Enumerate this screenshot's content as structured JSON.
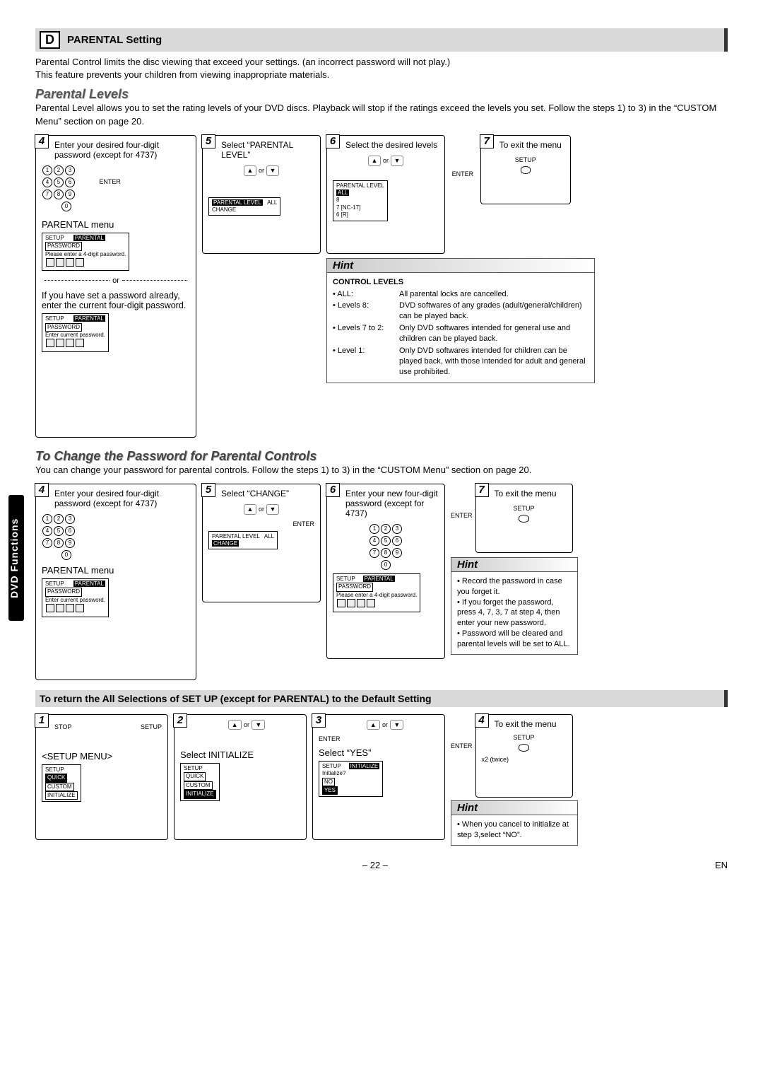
{
  "section_d": {
    "letter": "D",
    "title": "PARENTAL Setting"
  },
  "intro": {
    "line1": "Parental Control limits the disc viewing that exceed your settings. (an incorrect password will not play.)",
    "line2": "This feature prevents your children from viewing inappropriate materials."
  },
  "parental_levels": {
    "heading": "Parental Levels",
    "body": "Parental Level allows you to set the rating levels of your DVD discs. Playback will stop if the ratings exceed the levels you set. Follow the steps 1) to 3) in the “CUSTOM Menu” section on page 20."
  },
  "steps_pl": {
    "s4": {
      "num": "4",
      "text": "Enter your desired four-digit password (except for 4737)",
      "menu_label": "PARENTAL menu"
    },
    "s4_osd1": {
      "top1": "SETUP",
      "top2": "PARENTAL",
      "row": "PASSWORD",
      "msg": "Please enter a 4-digit password."
    },
    "or": "or",
    "s4_alt": "If you have set a password already, enter the current four-digit password.",
    "s4_osd2": {
      "top1": "SETUP",
      "top2": "PARENTAL",
      "row": "PASSWORD",
      "msg": "Enter current password."
    },
    "enter_label": "ENTER",
    "s5": {
      "num": "5",
      "text": "Select “PARENTAL LEVEL”",
      "or": "or",
      "osd": {
        "r1": "PARENTAL LEVEL",
        "v1": "ALL",
        "r2": "CHANGE"
      }
    },
    "s6": {
      "num": "6",
      "text": "Select the desired levels",
      "or": "or",
      "osd": {
        "h": "PARENTAL LEVEL",
        "o1": "ALL",
        "o2": "8",
        "o3": "7 [NC-17]",
        "o4": "6 [R]"
      }
    },
    "s7": {
      "num": "7",
      "text": "To exit the menu",
      "setup": "SETUP"
    }
  },
  "hint1": {
    "title": "Hint",
    "section": "CONTROL LEVELS",
    "rows": [
      {
        "k": "• ALL:",
        "v": "All parental locks are cancelled."
      },
      {
        "k": "• Levels 8:",
        "v": "DVD softwares of any grades (adult/general/children) can be played back."
      },
      {
        "k": "• Levels 7 to 2:",
        "v": "Only DVD softwares intended for general use and children can be played back."
      },
      {
        "k": "• Level 1:",
        "v": "Only DVD softwares intended for children can be played back, with those intended for adult and general use prohibited."
      }
    ]
  },
  "change_pw": {
    "heading": "To Change the Password for Parental Controls",
    "body": "You can change your password for parental controls.  Follow the steps 1) to 3) in the “CUSTOM Menu” section on page 20."
  },
  "steps_cp": {
    "s4": {
      "num": "4",
      "text": "Enter your desired four-digit password (except for 4737)",
      "menu_label": "PARENTAL menu",
      "osd": {
        "top1": "SETUP",
        "top2": "PARENTAL",
        "row": "PASSWORD",
        "msg": "Enter current password."
      }
    },
    "s5": {
      "num": "5",
      "text": "Select “CHANGE”",
      "or": "or",
      "enter": "ENTER",
      "osd": {
        "r1": "PARENTAL LEVEL",
        "v1": "ALL",
        "r2": "CHANGE"
      }
    },
    "s6": {
      "num": "6",
      "text": "Enter your new four-digit password (except for 4737)",
      "osd": {
        "top1": "SETUP",
        "top2": "PARENTAL",
        "row": "PASSWORD",
        "msg": "Please enter a 4-digit password."
      }
    },
    "s7": {
      "num": "7",
      "text": "To exit the menu",
      "setup": "SETUP",
      "enter": "ENTER"
    }
  },
  "hint2": {
    "title": "Hint",
    "items": [
      "Record the password in case you forget it.",
      "If you forget the password, press 4, 7, 3, 7 at step 4, then enter your new password.",
      "Password will be cleared and parental levels will be set to ALL."
    ]
  },
  "reset": {
    "heading": "To return the All Selections of SET UP (except for PARENTAL) to the Default Setting",
    "s1": {
      "num": "1",
      "stop": "STOP",
      "setup": "SETUP",
      "menu": "<SETUP MENU>",
      "osd": {
        "h": "SETUP",
        "o1": "QUICK",
        "o2": "CUSTOM",
        "o3": "INITIALIZE"
      }
    },
    "s2": {
      "num": "2",
      "or": "or",
      "text": "Select INITIALIZE",
      "osd": {
        "h": "SETUP",
        "o1": "QUICK",
        "o2": "CUSTOM",
        "o3": "INITIALIZE"
      }
    },
    "s3": {
      "num": "3",
      "or": "or",
      "enter": "ENTER",
      "text": "Select “YES”",
      "osd": {
        "h1": "SETUP",
        "h2": "INITIALIZE",
        "q": "Initialize?",
        "o1": "NO",
        "o2": "YES"
      }
    },
    "s4": {
      "num": "4",
      "text": "To exit the menu",
      "enter": "ENTER",
      "setup": "SETUP",
      "twice": "x2 (twice)"
    }
  },
  "hint3": {
    "title": "Hint",
    "text": "When you cancel to initialize at step 3,select “NO”."
  },
  "side_tab": "DVD Functions",
  "footer": {
    "page": "– 22 –",
    "lang": "EN"
  },
  "keypad": [
    "1",
    "2",
    "3",
    "4",
    "5",
    "6",
    "7",
    "8",
    "9",
    "0"
  ]
}
